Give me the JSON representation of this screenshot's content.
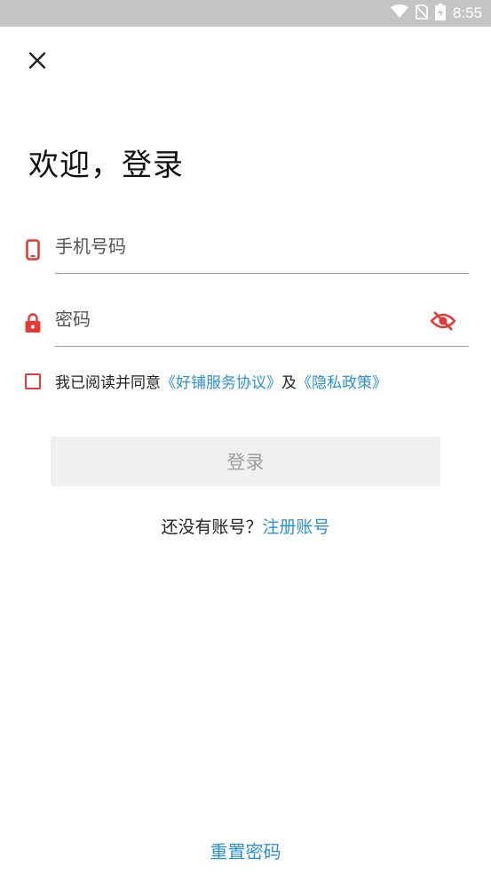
{
  "status_bar": {
    "time": "8:55",
    "icons": [
      "wifi-icon",
      "no-sim-icon",
      "battery-charging-icon"
    ]
  },
  "header": {
    "close_icon": "close-icon"
  },
  "title": "欢迎，登录",
  "phone": {
    "placeholder": "手机号码",
    "value": "",
    "icon": "phone-icon"
  },
  "password": {
    "placeholder": "密码",
    "value": "",
    "icon": "lock-icon",
    "toggle_icon": "eye-off-icon"
  },
  "agreement": {
    "checked": false,
    "prefix": "我已阅读并同意",
    "terms_link": "《好铺服务协议》",
    "and": "及",
    "privacy_link": "《隐私政策》"
  },
  "login_button": "登录",
  "register": {
    "prompt": "还没有账号？",
    "link": "注册账号"
  },
  "reset_password": "重置密码",
  "colors": {
    "accent_red": "#e53935",
    "link_blue": "#2b8fd6",
    "status_bar": "#c4c4c4",
    "button_disabled_bg": "#f0f0f0",
    "button_disabled_text": "#9e9e9e"
  }
}
